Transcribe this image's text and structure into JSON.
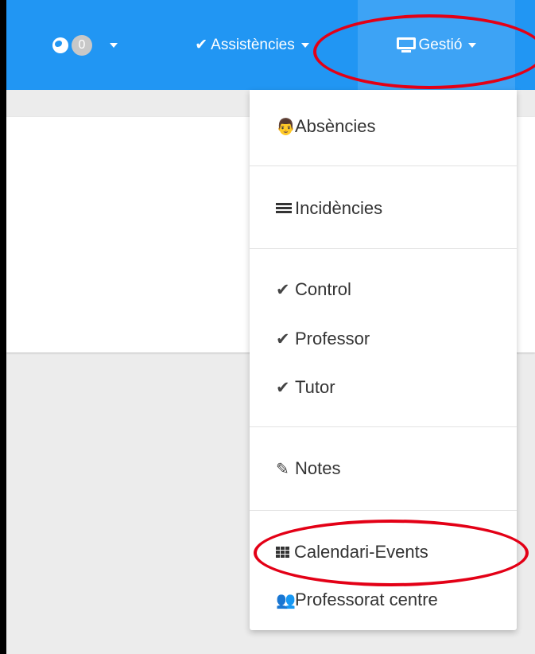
{
  "navbar": {
    "notifications": {
      "icon": "globe-icon",
      "count": "0"
    },
    "assistencies": {
      "icon": "check-icon",
      "label": "Assistències"
    },
    "gestio": {
      "icon": "monitor-icon",
      "label": "Gestió"
    }
  },
  "menu": {
    "items": [
      {
        "icon": "user-secret-icon",
        "label": "Absències"
      },
      {
        "icon": "list-icon",
        "label": "Incidències"
      },
      {
        "icon": "check-icon",
        "label": "Control"
      },
      {
        "icon": "check-icon",
        "label": "Professor"
      },
      {
        "icon": "check-icon",
        "label": "Tutor"
      },
      {
        "icon": "edit-icon",
        "label": "Notes"
      },
      {
        "icon": "grid-icon",
        "label": "Calendari-Events"
      },
      {
        "icon": "users-icon",
        "label": "Professorat centre"
      }
    ]
  },
  "colors": {
    "navbar": "#2196f3",
    "annotation": "#e30016"
  }
}
